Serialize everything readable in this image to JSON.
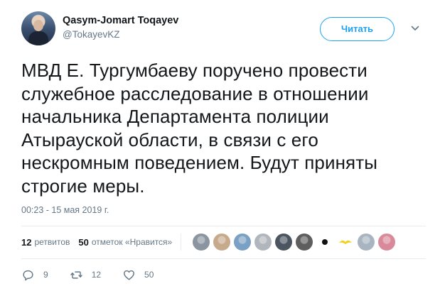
{
  "tweet": {
    "author": {
      "display_name": "Qasym-Jomart Toqayev",
      "handle": "@TokayevKZ"
    },
    "follow_button_label": "Читать",
    "text": "МВД Е. Тургумбаеву поручено провести служебное расследование в отношении начальника Департамента полиции Атырауской области, в связи с его нескромным поведением. Будут приняты строгие меры.",
    "timestamp": "00:23 - 15 мая 2019 г.",
    "stats": {
      "retweets_count": "12",
      "retweets_label": "ретвитов",
      "likes_count": "50",
      "likes_label": "отметок «Нравится»"
    },
    "liker_avatars": [
      {
        "name": "liker-avatar-1",
        "color": "#8a95a0"
      },
      {
        "name": "liker-avatar-2",
        "color": "#c7a98c"
      },
      {
        "name": "liker-avatar-3",
        "color": "#7aa0c4"
      },
      {
        "name": "liker-avatar-4",
        "color": "#b0b6bc"
      },
      {
        "name": "liker-avatar-5",
        "color": "#4a5560"
      },
      {
        "name": "liker-avatar-6",
        "color": "#5e5e5e"
      },
      {
        "name": "liker-avatar-7",
        "color": "#111111"
      },
      {
        "name": "liker-avatar-8",
        "color": "#f2d21e"
      },
      {
        "name": "liker-avatar-9",
        "color": "#a8b4bf"
      },
      {
        "name": "liker-avatar-10",
        "color": "#d98a9a"
      }
    ],
    "actions": {
      "replies": "9",
      "retweets": "12",
      "likes": "50"
    },
    "colors": {
      "accent": "#1da1f2",
      "secondary_text": "#657786",
      "primary_text": "#14171a",
      "divider": "#e6ecf0"
    }
  }
}
